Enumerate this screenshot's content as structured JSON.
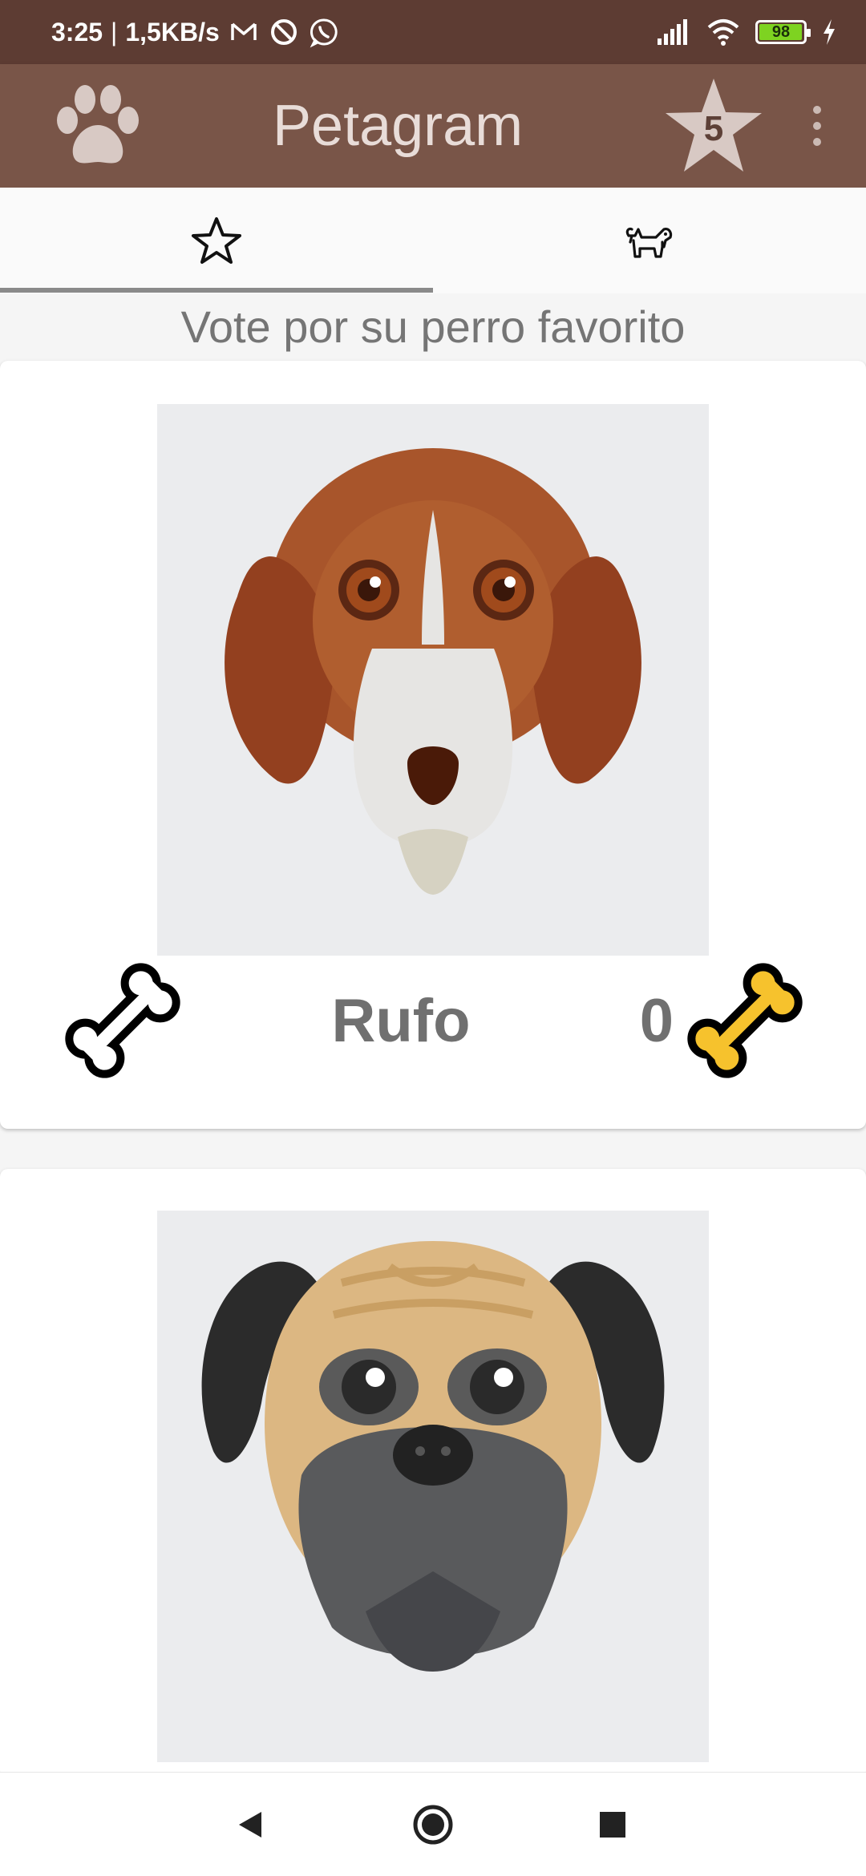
{
  "status_bar": {
    "time": "3:25",
    "separator": "|",
    "speed": "1,5KB/s",
    "battery": "98",
    "battery_level": 0.98,
    "icons": [
      "gmail-icon",
      "sync-icon",
      "whatsapp-icon",
      "signal-icon",
      "wifi-icon",
      "battery-icon",
      "charging-icon"
    ]
  },
  "app_bar": {
    "title": "Petagram",
    "favorites_count": "5",
    "icons": [
      "paw-icon",
      "star-icon",
      "more-vert-icon"
    ]
  },
  "tabs": [
    {
      "icon": "star-outline-icon",
      "selected": true
    },
    {
      "icon": "dog-icon",
      "selected": false
    }
  ],
  "subtitle": "Vote por su perro favorito",
  "pets": [
    {
      "name": "Rufo",
      "rating": "0",
      "image": "beagle-face"
    },
    {
      "name": "",
      "rating": "",
      "image": "pug-face"
    }
  ],
  "colors": {
    "status_bar": "#5d3c33",
    "app_bar": "#795548",
    "tab_indicator": "#8a8a8a",
    "bone_rated": "#f6c22d"
  },
  "nav_bar": {
    "icons": [
      "back-icon",
      "home-icon",
      "recents-icon"
    ]
  }
}
